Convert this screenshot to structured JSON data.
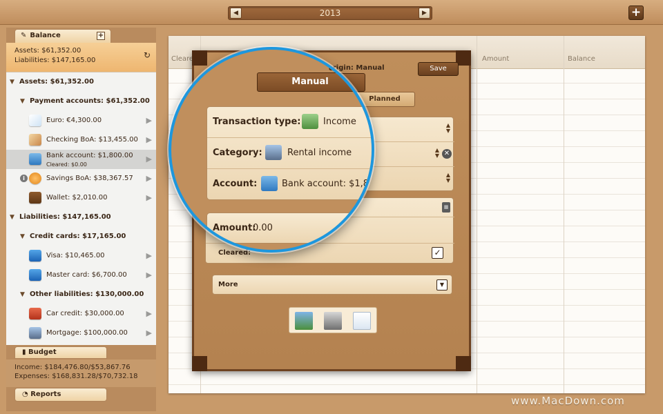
{
  "toolbar": {
    "year": "2013",
    "prev_icon": "arrow-left-icon",
    "next_icon": "arrow-right-icon",
    "add_label": "+"
  },
  "sidebar": {
    "balance_tab": {
      "label": "Balance",
      "add_label": "+"
    },
    "summary": {
      "assets": "Assets: $61,352.00",
      "liabilities": "Liabilities: $147,165.00"
    },
    "tree": {
      "assets": "Assets: $61,352.00",
      "payment_accounts": "Payment accounts: $61,352.00",
      "accounts_assets": [
        {
          "label": "Euro: €4,300.00",
          "icon": "note-icon"
        },
        {
          "label": "Checking BoA: $13,455.00",
          "icon": "pencil-ruler-icon"
        },
        {
          "label": "Bank account: $1,800.00",
          "sub": "Cleared: $0.00",
          "icon": "bank-icon"
        },
        {
          "label": "Savings BoA: $38,367.57",
          "icon": "piggy-bank-icon",
          "info": "i"
        },
        {
          "label": "Wallet: $2,010.00",
          "icon": "wallet-icon"
        }
      ],
      "liabilities": "Liabilities: $147,165.00",
      "credit_cards": "Credit cards: $17,165.00",
      "accounts_cards": [
        {
          "label": "Visa: $10,465.00",
          "icon": "credit-card-icon"
        },
        {
          "label": "Master card: $6,700.00",
          "icon": "credit-card-icon"
        }
      ],
      "other_liabilities": "Other liabilities: $130,000.00",
      "accounts_other": [
        {
          "label": "Car credit: $30,000.00",
          "icon": "car-icon"
        },
        {
          "label": "Mortgage: $100,000.00",
          "icon": "house-icon"
        }
      ]
    },
    "budget_tab": {
      "label": "Budget"
    },
    "budget_summary": {
      "income": "Income: $184,476.80/$53,867.76",
      "expenses": "Expenses: $168,831.28/$70,732.18"
    },
    "reports_tab": {
      "label": "Reports"
    }
  },
  "ledger": {
    "columns": [
      "Cleare",
      "Amount",
      "Balance"
    ]
  },
  "dialog": {
    "title": "origin: Manual",
    "save_label": "Save",
    "segment_manual": "Manual",
    "segment_planned": "Planned",
    "cleared_label": "Cleared:",
    "cleared_checked": "✓",
    "more_label": "More",
    "transaction_type_label": "Transaction type:",
    "transaction_type_value": "Income",
    "category_label": "Category:",
    "category_value": "Rental income",
    "account_label": "Account:",
    "account_value": "Bank account: $1,8",
    "amount_label": "Amount:",
    "amount_value": "0.00"
  },
  "watermark": "www.MacDown.com",
  "colors": {
    "accent_blue": "#1d97de",
    "leather": "#b48250",
    "dark_brown": "#6e4221"
  }
}
